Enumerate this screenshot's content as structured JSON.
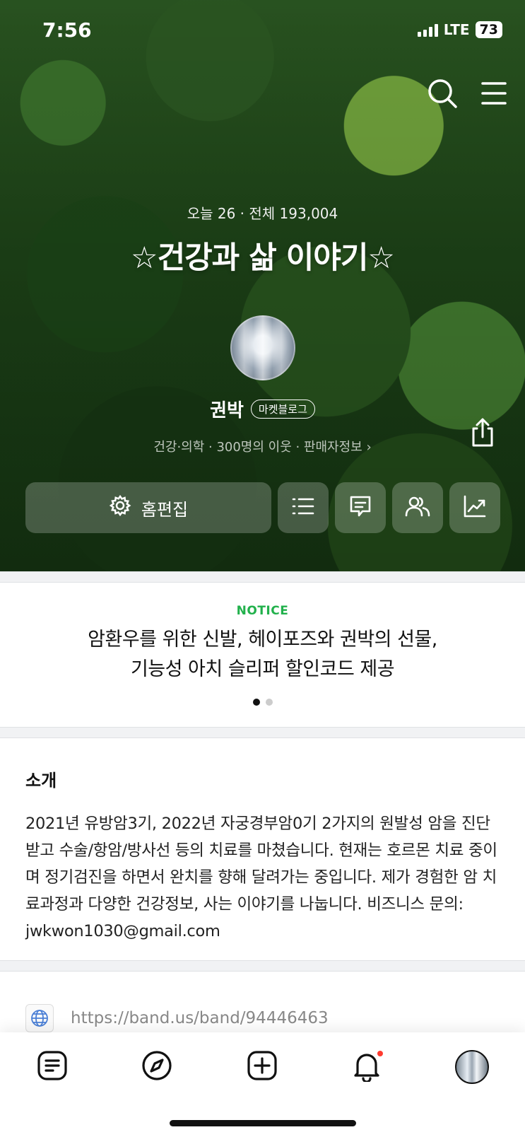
{
  "status_bar": {
    "time": "7:56",
    "network": "LTE",
    "battery": "73"
  },
  "header": {
    "visits": "오늘 26  ·  전체 193,004",
    "blog_title": "☆건강과 삶 이야기☆"
  },
  "profile": {
    "name": "권박",
    "badge": "마켓블로그",
    "meta": "건강·의학 · 300명의 이웃 · 판매자정보 ›"
  },
  "actions": {
    "edit_label": "홈편집"
  },
  "notice": {
    "label": "NOTICE",
    "line1": "암환우를 위한 신발, 헤이포즈와 권박의 선물,",
    "line2": "기능성 아치 슬리퍼 할인코드 제공"
  },
  "intro": {
    "title": "소개",
    "body": "2021년 유방암3기, 2022년 자궁경부암0기 2가지의 원발성 암을 진단 받고 수술/항암/방사선 등의 치료를 마쳤습니다. 현재는 호르몬 치료 중이며 정기검진을 하면서 완치를 향해 달려가는 중입니다. 제가 경험한 암 치료과정과 다양한 건강정보, 사는 이야기를 나눕니다.  비즈니스 문의:  jwkwon1030@gmail.com"
  },
  "link": {
    "url": "https://band.us/band/94446463"
  },
  "colors": {
    "notice_green": "#22b14c",
    "notification_red": "#ff3b30"
  },
  "icons": [
    "search-icon",
    "menu-icon",
    "share-icon",
    "gear-icon",
    "list-icon",
    "comment-icon",
    "neighbors-icon",
    "stats-icon",
    "globe-icon",
    "feed-icon",
    "compass-icon",
    "add-post-icon",
    "bell-icon"
  ]
}
